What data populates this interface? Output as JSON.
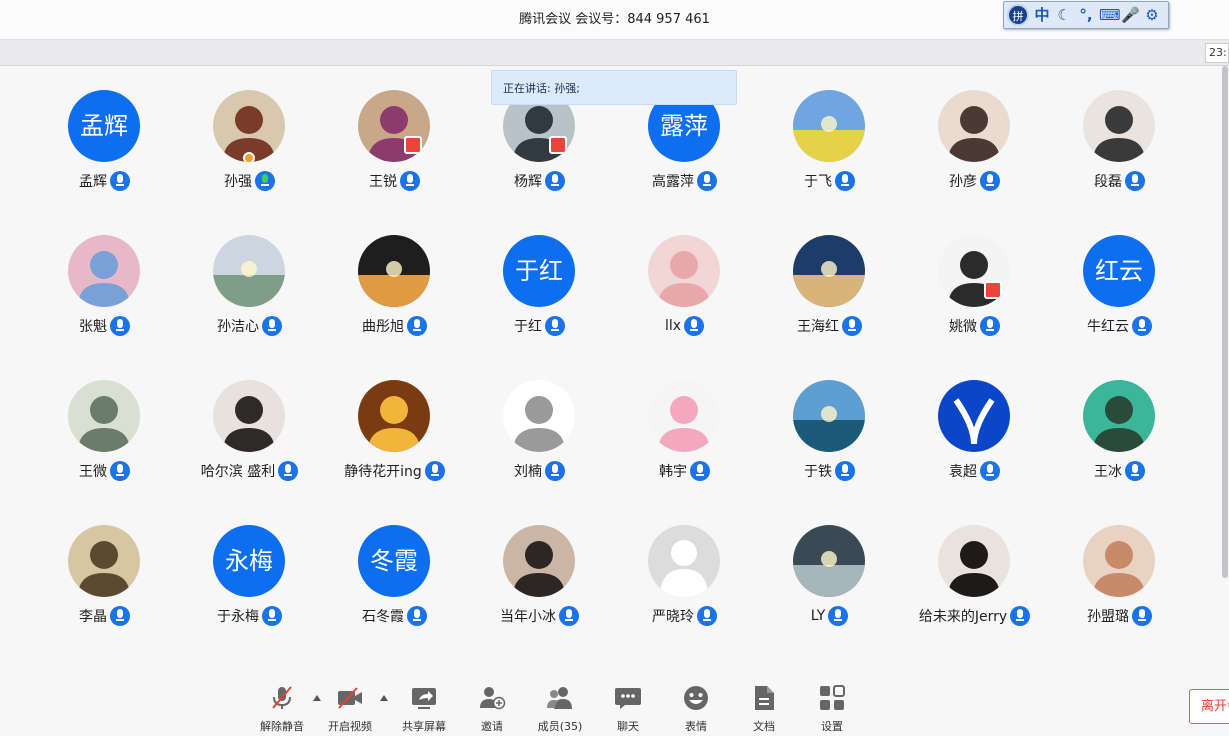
{
  "window": {
    "title": "腾讯会议 会议号：844 957 461"
  },
  "ime": {
    "logo": "拼",
    "glyphs": [
      "中",
      "☾",
      "°,",
      "⌨",
      "🎤",
      "⚙"
    ]
  },
  "clock": {
    "text": "23:"
  },
  "speaking": {
    "text": "正在讲话: 孙强;"
  },
  "participants": [
    {
      "name": "孟辉",
      "avatar_text": "孟辉"
    },
    {
      "name": "孙强",
      "avatar_text": ""
    },
    {
      "name": "王锐",
      "avatar_text": ""
    },
    {
      "name": "杨辉",
      "avatar_text": ""
    },
    {
      "name": "高露萍",
      "avatar_text": "露萍"
    },
    {
      "name": "于飞",
      "avatar_text": ""
    },
    {
      "name": "孙彦",
      "avatar_text": ""
    },
    {
      "name": "段磊",
      "avatar_text": ""
    },
    {
      "name": "张魁",
      "avatar_text": ""
    },
    {
      "name": "孙洁心",
      "avatar_text": ""
    },
    {
      "name": "曲彤旭",
      "avatar_text": ""
    },
    {
      "name": "于红",
      "avatar_text": "于红"
    },
    {
      "name": "llx",
      "avatar_text": ""
    },
    {
      "name": "王海红",
      "avatar_text": ""
    },
    {
      "name": "姚微",
      "avatar_text": ""
    },
    {
      "name": "牛红云",
      "avatar_text": "红云"
    },
    {
      "name": "王微",
      "avatar_text": ""
    },
    {
      "name": "哈尔滨 盛利",
      "avatar_text": ""
    },
    {
      "name": "静待花开ing",
      "avatar_text": ""
    },
    {
      "name": "刘楠",
      "avatar_text": ""
    },
    {
      "name": "韩宇",
      "avatar_text": ""
    },
    {
      "name": "于铁",
      "avatar_text": ""
    },
    {
      "name": "袁超",
      "avatar_text": ""
    },
    {
      "name": "王冰",
      "avatar_text": ""
    },
    {
      "name": "李晶",
      "avatar_text": ""
    },
    {
      "name": "于永梅",
      "avatar_text": "永梅"
    },
    {
      "name": "石冬霞",
      "avatar_text": "冬霞"
    },
    {
      "name": "当年小冰",
      "avatar_text": ""
    },
    {
      "name": "严晓玲",
      "avatar_text": ""
    },
    {
      "name": "LY",
      "avatar_text": ""
    },
    {
      "name": "给未来的Jerry",
      "avatar_text": ""
    },
    {
      "name": "孙盟璐",
      "avatar_text": ""
    }
  ],
  "toolbar": {
    "unmute": "解除静音",
    "video": "开启视频",
    "share": "共享屏幕",
    "invite": "邀请",
    "members": "成员(35)",
    "chat": "聊天",
    "emoji": "表情",
    "docs": "文档",
    "settings": "设置",
    "leave": "离开会议"
  }
}
